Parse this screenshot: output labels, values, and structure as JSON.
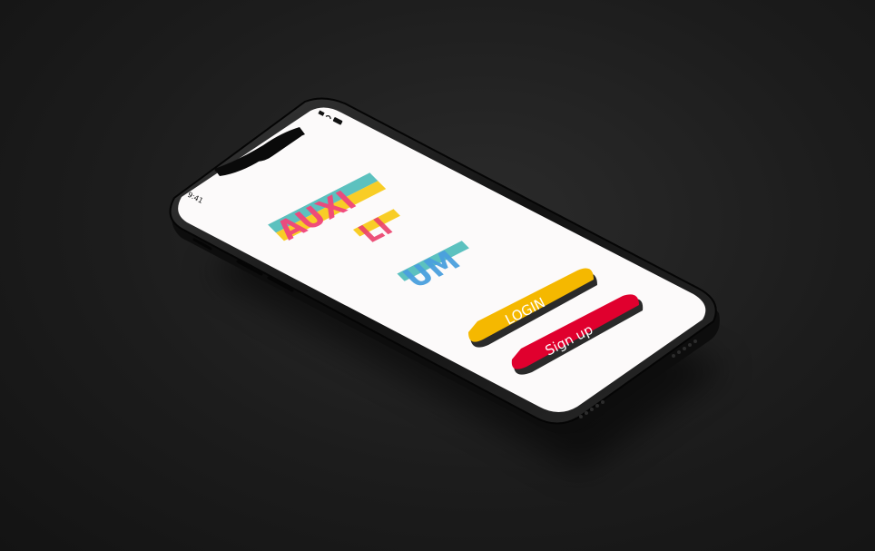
{
  "status_bar": {
    "time": "9:41"
  },
  "logo": {
    "lines": [
      "AUXI",
      "LI",
      "UM"
    ]
  },
  "buttons": {
    "login_label": "LOGIN",
    "signup_label": "Sign up"
  },
  "colors": {
    "background": "#1c1c1c",
    "screen": "#fcfafa",
    "login_button": "#f5b800",
    "signup_button": "#e0002e",
    "logo_yellow": "#f7c400",
    "logo_pink": "#ea3f6a",
    "logo_blue": "#4a9fdd",
    "logo_teal": "#3fb6b4"
  },
  "icons": {
    "status_right": [
      "signal-icon",
      "wifi-icon",
      "battery-icon"
    ]
  }
}
